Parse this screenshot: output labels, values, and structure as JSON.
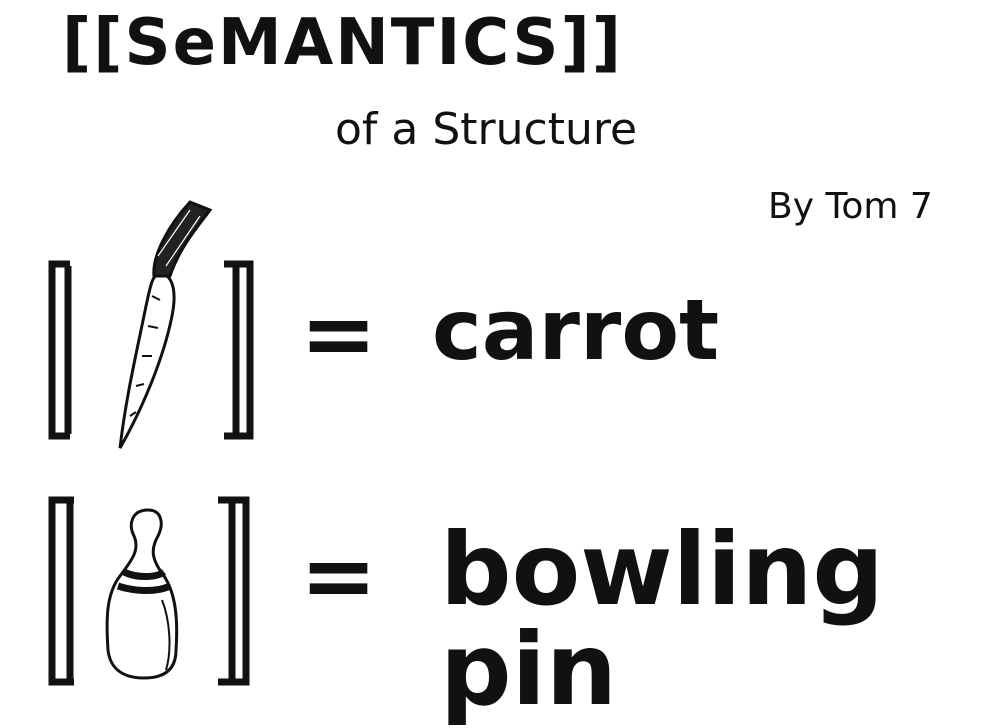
{
  "title": {
    "left_bracket": "[[",
    "text": "SeMANTICS",
    "right_bracket": "]]"
  },
  "subtitle": "of a Structure",
  "byline": "By Tom 7",
  "rows": [
    {
      "illustration": "carrot-icon",
      "equals": "=",
      "word": "carrot"
    },
    {
      "illustration": "bowling-pin-icon",
      "equals": "=",
      "word": "bowling pin"
    }
  ]
}
